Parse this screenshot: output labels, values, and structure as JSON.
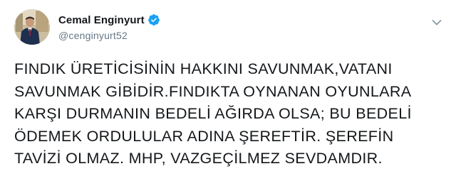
{
  "tweet": {
    "author": {
      "display_name": "Cemal Enginyurt",
      "handle": "@cenginyurt52",
      "verified": true,
      "avatar_icon": "profile-photo"
    },
    "text": "FINDIK ÜRETİCİSİNİN HAKKINI SAVUNMAK,VATANI\nSAVUNMAK GİBİDİR.FINDIKTA OYNANAN OYUNLARA\nKARŞI DURMANIN BEDELİ AĞIRDA OLSA; BU BEDELİ\nÖDEMEK ORDULULAR ADINA ŞEREFTİR. ŞEREFİN\nTAVİZİ OLMAZ. MHP, VAZGEÇİLMEZ SEVDAMDIR.",
    "menu_icon": "chevron-down-icon"
  },
  "colors": {
    "name": "#14171a",
    "handle": "#657786",
    "verified": "#1da1f2",
    "text": "#14171a",
    "background": "#ffffff"
  }
}
